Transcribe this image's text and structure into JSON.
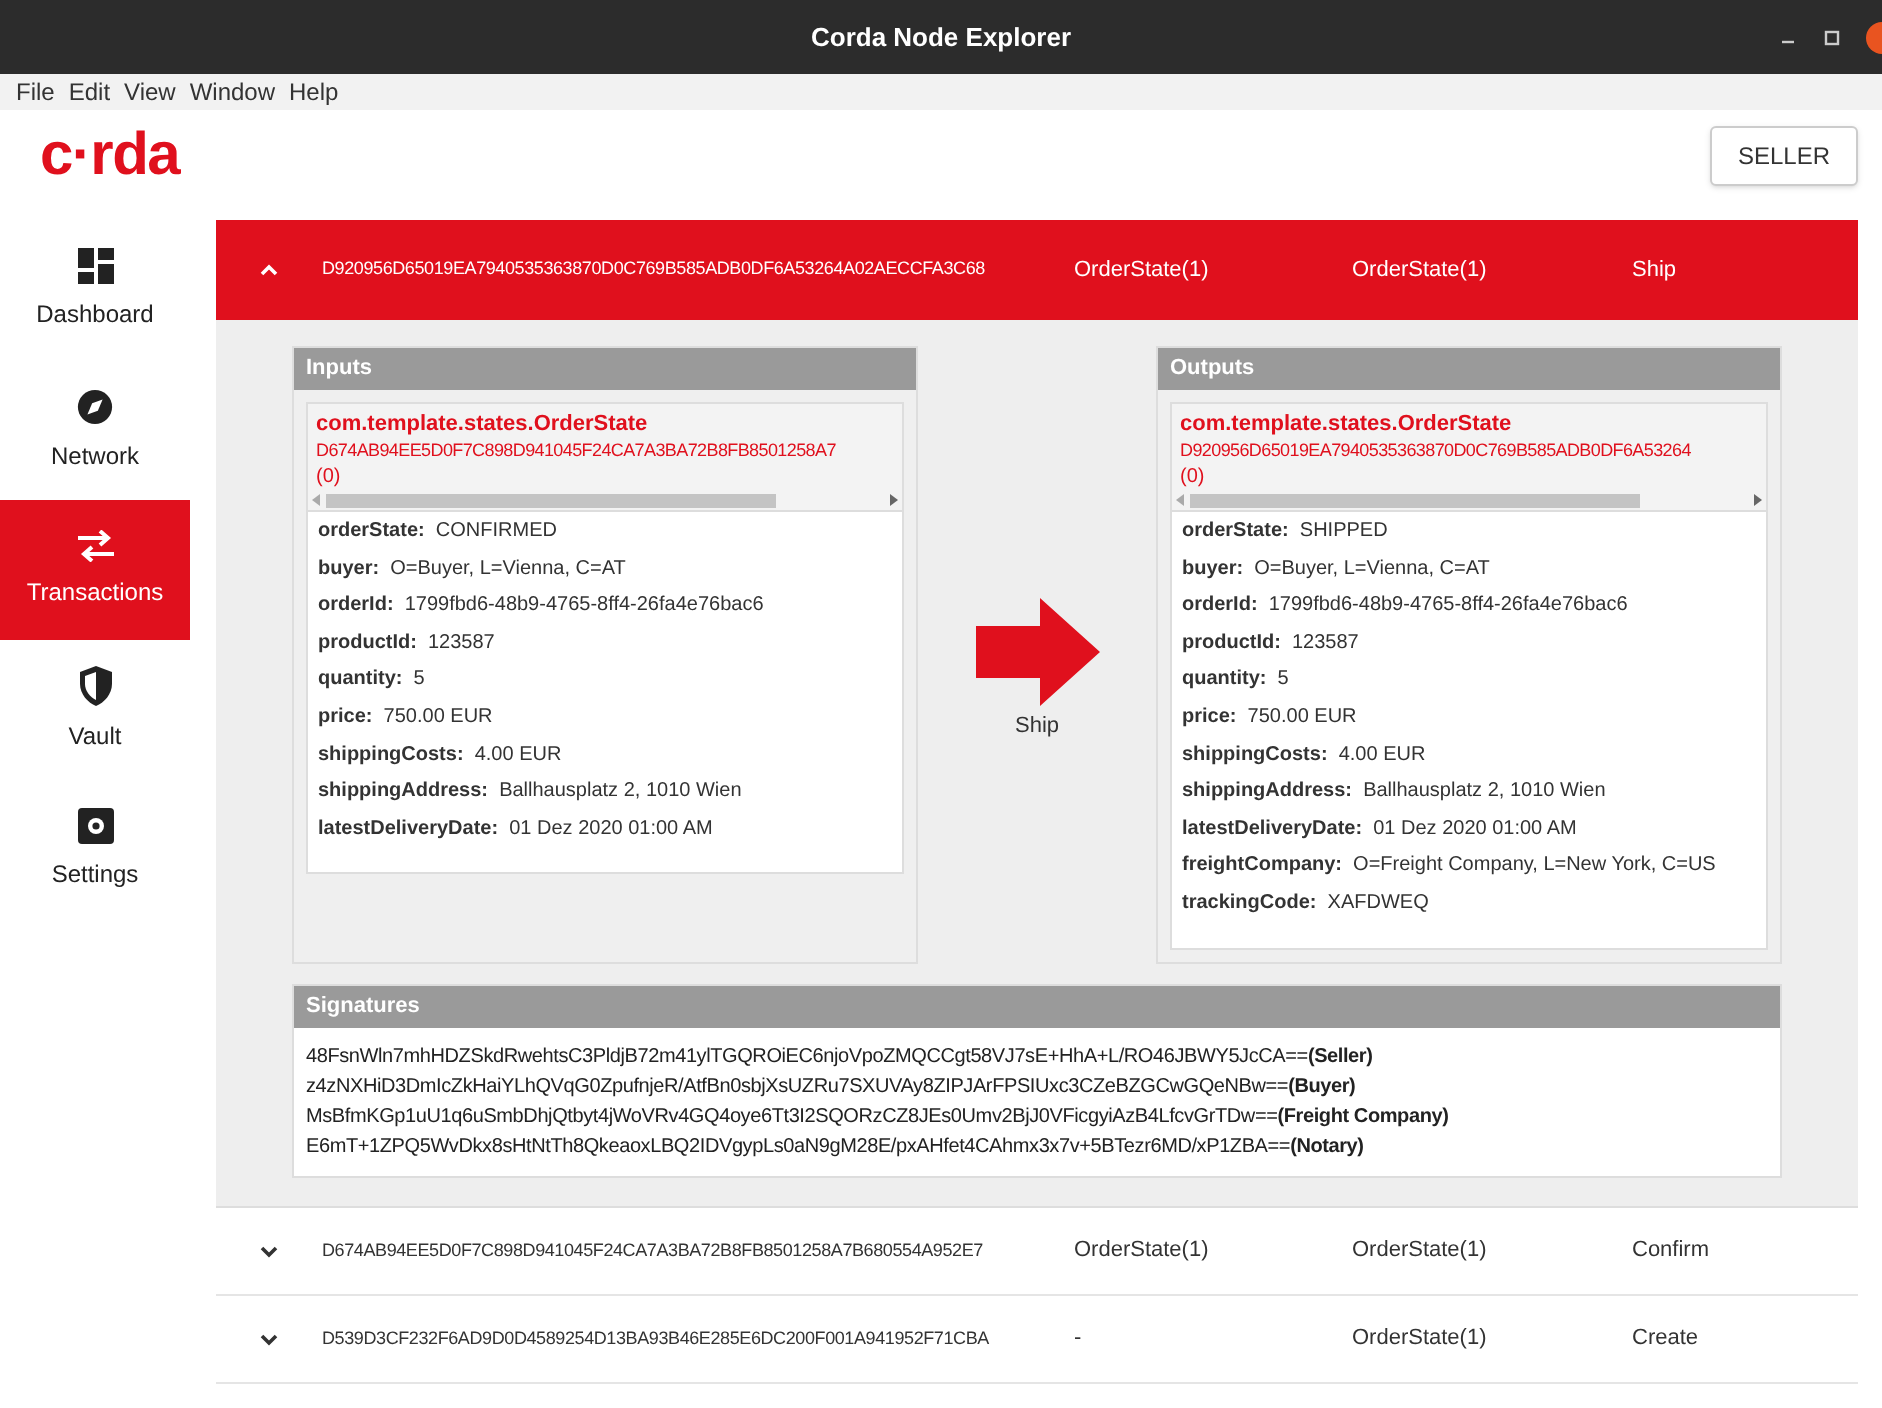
{
  "window": {
    "title": "Corda Node Explorer"
  },
  "menu": [
    "File",
    "Edit",
    "View",
    "Window",
    "Help"
  ],
  "logo": "c·rda",
  "node_button": "SELLER",
  "sidebar": {
    "items": [
      {
        "label": "Dashboard",
        "kind": "dashboard",
        "selected": false
      },
      {
        "label": "Network",
        "kind": "network",
        "selected": false
      },
      {
        "label": "Transactions",
        "kind": "transactions",
        "selected": true
      },
      {
        "label": "Vault",
        "kind": "vault",
        "selected": false
      },
      {
        "label": "Settings",
        "kind": "settings",
        "selected": false
      }
    ]
  },
  "transactions": [
    {
      "id": "D920956D65019EA7940535363870D0C769B585ADB0DF6A53264A02AECCFA3C68",
      "inputs": "OrderState(1)",
      "outputs": "OrderState(1)",
      "command": "Ship",
      "expanded": true,
      "details": {
        "inputs": {
          "title": "Inputs",
          "states": [
            {
              "type": "com.template.states.OrderState",
              "ref": "D674AB94EE5D0F7C898D941045F24CA7A3BA72B8FB8501258A7",
              "index": "(0)",
              "fields": [
                {
                  "key": "orderState:",
                  "value": "CONFIRMED"
                },
                {
                  "key": "buyer:",
                  "value": "O=Buyer, L=Vienna, C=AT"
                },
                {
                  "key": "orderId:",
                  "value": "1799fbd6-48b9-4765-8ff4-26fa4e76bac6"
                },
                {
                  "key": "productId:",
                  "value": "123587"
                },
                {
                  "key": "quantity:",
                  "value": "5"
                },
                {
                  "key": "price:",
                  "value": "750.00 EUR"
                },
                {
                  "key": "shippingCosts:",
                  "value": "4.00 EUR"
                },
                {
                  "key": "shippingAddress:",
                  "value": "Ballhausplatz 2, 1010 Wien"
                },
                {
                  "key": "latestDeliveryDate:",
                  "value": "01 Dez 2020 01:00 AM"
                }
              ]
            }
          ]
        },
        "command": "Ship",
        "outputs": {
          "title": "Outputs",
          "states": [
            {
              "type": "com.template.states.OrderState",
              "ref": "D920956D65019EA7940535363870D0C769B585ADB0DF6A53264",
              "index": "(0)",
              "fields": [
                {
                  "key": "orderState:",
                  "value": "SHIPPED"
                },
                {
                  "key": "buyer:",
                  "value": "O=Buyer, L=Vienna, C=AT"
                },
                {
                  "key": "orderId:",
                  "value": "1799fbd6-48b9-4765-8ff4-26fa4e76bac6"
                },
                {
                  "key": "productId:",
                  "value": "123587"
                },
                {
                  "key": "quantity:",
                  "value": "5"
                },
                {
                  "key": "price:",
                  "value": "750.00 EUR"
                },
                {
                  "key": "shippingCosts:",
                  "value": "4.00 EUR"
                },
                {
                  "key": "shippingAddress:",
                  "value": "Ballhausplatz 2, 1010 Wien"
                },
                {
                  "key": "latestDeliveryDate:",
                  "value": "01 Dez 2020 01:00 AM"
                },
                {
                  "key": "freightCompany:",
                  "value": "O=Freight Company, L=New York, C=US"
                },
                {
                  "key": "trackingCode:",
                  "value": "XAFDWEQ"
                }
              ]
            }
          ]
        },
        "signatures": {
          "title": "Signatures",
          "lines": [
            "48FsnWln7mhHDZSkdRwehtsC3PldjB72m41ylTGQROiEC6njoVpoZMQCCgt58VJ7sE+HhA+L/RO46JBWY5JcCA==**(Seller)**",
            "z4zNXHiD3DmIcZkHaiYLhQVqG0ZpufnjeR/AtfBn0sbjXsUZRu7SXUVAy8ZIPJArFPSIUxc3CZeBZGCwGQeNBw==**(Buyer)**",
            "MsBfmKGp1uU1q6uSmbDhjQtbyt4jWoVRv4GQ4oye6Tt3I2SQORzCZ8JEs0Umv2BjJ0VFicgyiAzB4LfcvGrTDw==**(Freight Company)**",
            "E6mT+1ZPQ5WvDkx8sHtNtTh8QkeaoxLBQ2IDVgypLs0aN9gM28E/pxAHfet4CAhmx3x7v+5BTezr6MD/xP1ZBA==**(Notary)**"
          ]
        }
      }
    },
    {
      "id": "D674AB94EE5D0F7C898D941045F24CA7A3BA72B8FB8501258A7B680554A952E7",
      "inputs": "OrderState(1)",
      "outputs": "OrderState(1)",
      "command": "Confirm",
      "expanded": false
    },
    {
      "id": "D539D3CF232F6AD9D0D4589254D13BA93B46E285E6DC200F001A941952F71CBA",
      "inputs": "-",
      "outputs": "OrderState(1)",
      "command": "Create",
      "expanded": false
    }
  ]
}
